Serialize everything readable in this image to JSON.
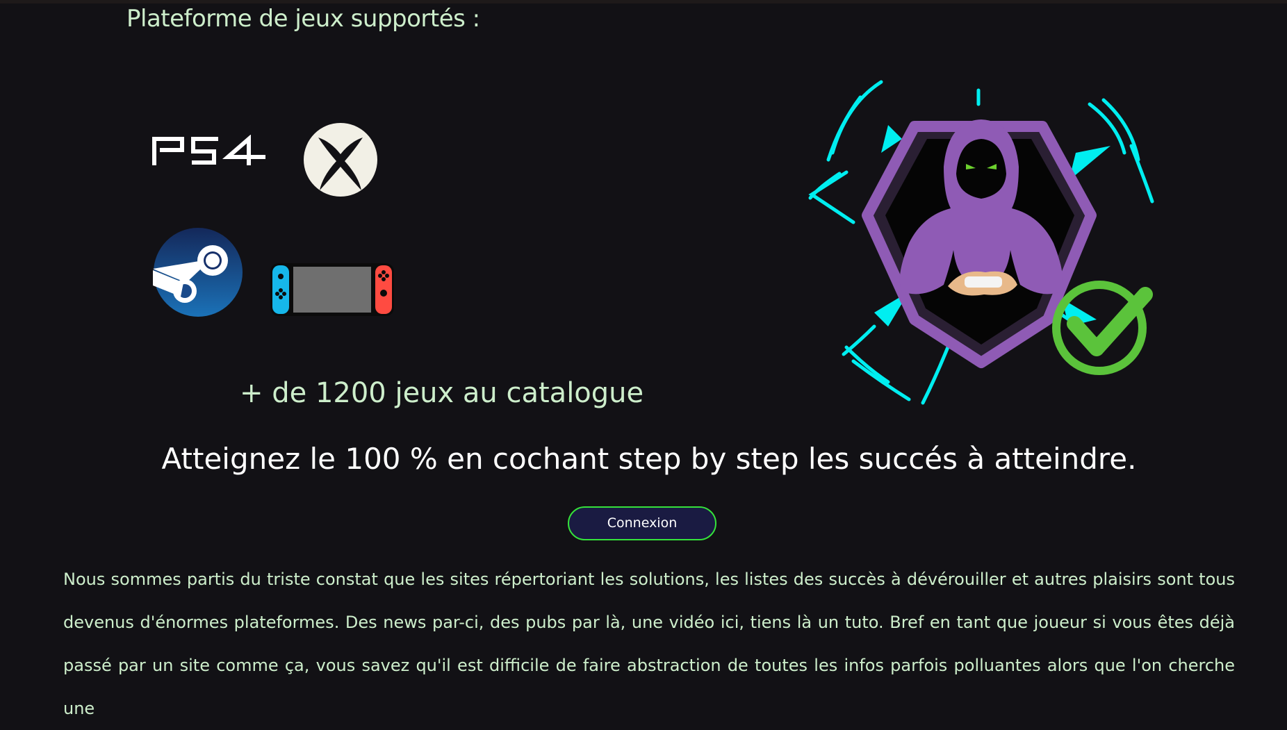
{
  "section": {
    "title": "Plateforme de jeux supportés :"
  },
  "platforms": [
    {
      "name": "ps4-logo",
      "icon": "ps4-icon"
    },
    {
      "name": "xbox-logo",
      "icon": "xbox-icon"
    },
    {
      "name": "steam-logo",
      "icon": "steam-icon"
    },
    {
      "name": "switch-logo",
      "icon": "nintendo-switch-icon"
    }
  ],
  "hero": {
    "image": "hooded-gamer-shield-checkmark-logo"
  },
  "catalogue": {
    "text": "+ de 1200 jeux au catalogue"
  },
  "tagline": {
    "text": "Atteignez le 100 % en cochant step by step les succés à atteindre."
  },
  "login": {
    "label": "Connexion"
  },
  "description": {
    "text": "Nous sommes partis du triste constat que les sites répertoriant les solutions, les listes des succès à dévérouiller et autres plaisirs sont tous devenus d'énormes plateformes. Des news par-ci, des pubs par là, une vidéo ici, tiens là un tuto. Bref en tant que joueur si vous êtes déjà passé par un site comme ça, vous savez qu'il est difficile de faire abstraction de toutes les infos parfois polluantes alors que l'on cherche une"
  },
  "colors": {
    "background": "#121115",
    "text_green": "#cdeecb",
    "button_bg": "#1a1b42",
    "button_border": "#35e33a",
    "accent_cyan": "#00eef0",
    "accent_purple": "#8f5bb5",
    "check_green": "#5bc33b"
  }
}
